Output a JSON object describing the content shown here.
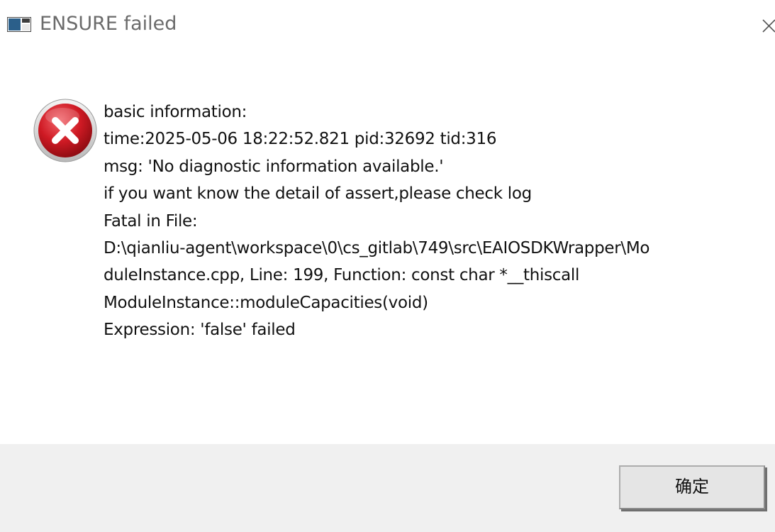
{
  "window": {
    "title": "ENSURE failed"
  },
  "dialog": {
    "icon": "error-icon",
    "message_lines": [
      "basic information:",
      "time:2025-05-06 18:22:52.821 pid:32692 tid:316",
      "msg: 'No diagnostic information available.'",
      "if you want know the detail of assert,please check log",
      "Fatal in File:",
      "D:\\qianliu-agent\\workspace\\0\\cs_gitlab\\749\\src\\EAIOSDKWrapper\\Mo",
      "duleInstance.cpp, Line: 199, Function: const char *__thiscall",
      "ModuleInstance::moduleCapacities(void)",
      "Expression: 'false' failed"
    ]
  },
  "buttons": {
    "ok_label": "确定"
  },
  "colors": {
    "error_red": "#c8141e",
    "footer_bg": "#f0f0f0",
    "title_text": "#6b6b6b"
  }
}
